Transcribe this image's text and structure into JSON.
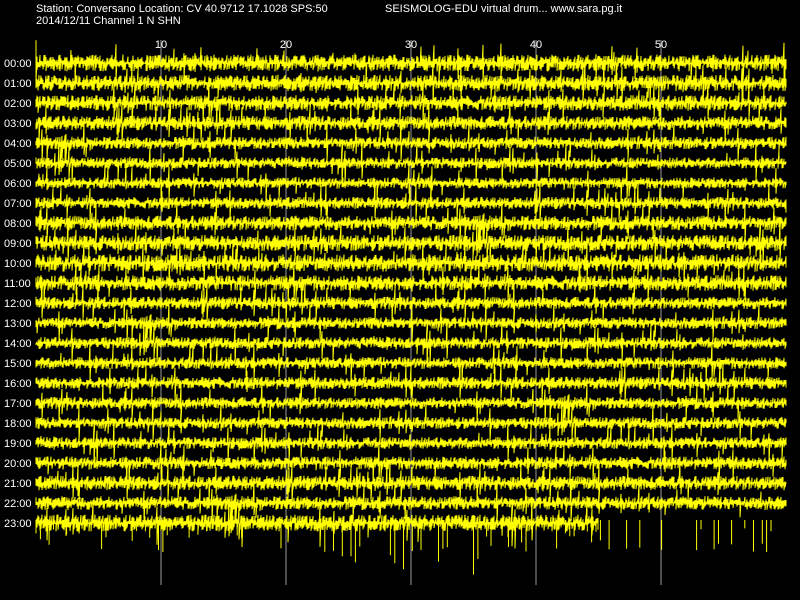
{
  "header": {
    "station_line": "Station: Conversano Location: CV 40.9712 17.1028 SPS:50",
    "brand_line": "SEISMOLOG-EDU virtual drum... www.sara.pg.it",
    "date_line": "2014/12/11  Channel 1 N SHN"
  },
  "colors": {
    "background": "#000000",
    "trace": "#ffff00",
    "gridline": "#9a9a9a",
    "text": "#ffffff"
  },
  "chart_data": {
    "type": "line",
    "title": "",
    "xlabel": "",
    "ylabel": "",
    "x_unit_note": "",
    "xlim": [
      0,
      60
    ],
    "x_ticks": [
      "10",
      "20",
      "30",
      "40",
      "50"
    ],
    "x_tick_values": [
      10,
      20,
      30,
      40,
      50
    ],
    "grid": true,
    "hours": [
      "00:00",
      "01:00",
      "02:00",
      "03:00",
      "04:00",
      "05:00",
      "06:00",
      "07:00",
      "08:00",
      "09:00",
      "10:00",
      "11:00",
      "12:00",
      "13:00",
      "14:00",
      "15:00",
      "16:00",
      "17:00",
      "18:00",
      "19:00",
      "20:00",
      "21:00",
      "22:00",
      "23:00"
    ],
    "last_trace_end_minute": 45,
    "relative_activity_by_hour": [
      0.9,
      0.85,
      0.8,
      0.7,
      0.55,
      0.45,
      0.45,
      0.5,
      0.75,
      0.85,
      0.95,
      0.8,
      0.55,
      0.5,
      0.5,
      0.5,
      0.55,
      0.5,
      0.5,
      0.5,
      0.6,
      0.7,
      0.65,
      0.9
    ]
  }
}
